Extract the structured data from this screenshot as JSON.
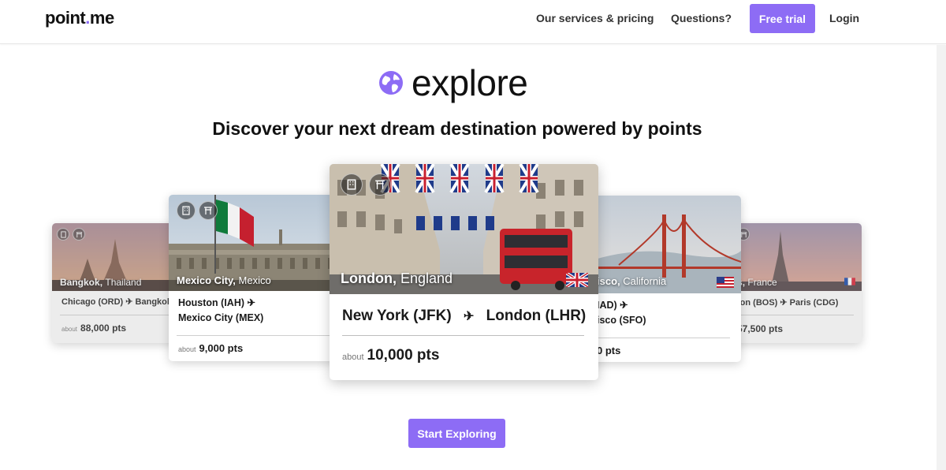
{
  "header": {
    "logo_text": "point",
    "logo_dot": ".",
    "logo_text_end": "me",
    "nav": {
      "services": "Our services & pricing",
      "questions": "Questions?",
      "free_trial": "Free trial",
      "login": "Login"
    }
  },
  "hero": {
    "title": "explore",
    "subtitle": "Discover your next dream destination powered by points"
  },
  "cards": [
    {
      "city": "Bangkok",
      "country": "Thailand",
      "route": "Chicago (ORD) ✈ Bangkok",
      "about": "about",
      "points": "88,000 pts"
    },
    {
      "city": "Mexico City",
      "country": "Mexico",
      "route_line1": "Houston (IAH) ✈",
      "route_line2": "Mexico City (MEX)",
      "about": "about",
      "points": "9,000 pts"
    },
    {
      "city": "London",
      "country": "England",
      "origin": "New York (JFK)",
      "plane": "✈",
      "destination": "London (LHR)",
      "about": "about",
      "points": "10,000 pts"
    },
    {
      "city": "isco",
      "country": "California",
      "route_line1": "IAD) ✈",
      "route_line2": "isco (SFO)",
      "points": "0 pts"
    },
    {
      "city": "s",
      "country": "France",
      "route": "ton (BOS) ✈ Paris (CDG)",
      "points": "57,500 pts"
    }
  ],
  "cta": {
    "label": "Start Exploring"
  },
  "colors": {
    "accent": "#8d6cf5"
  },
  "icons": [
    "globe-icon",
    "building-icon",
    "gate-icon",
    "plane-icon",
    "flag-uk-icon",
    "flag-us-icon",
    "flag-fr-icon"
  ]
}
